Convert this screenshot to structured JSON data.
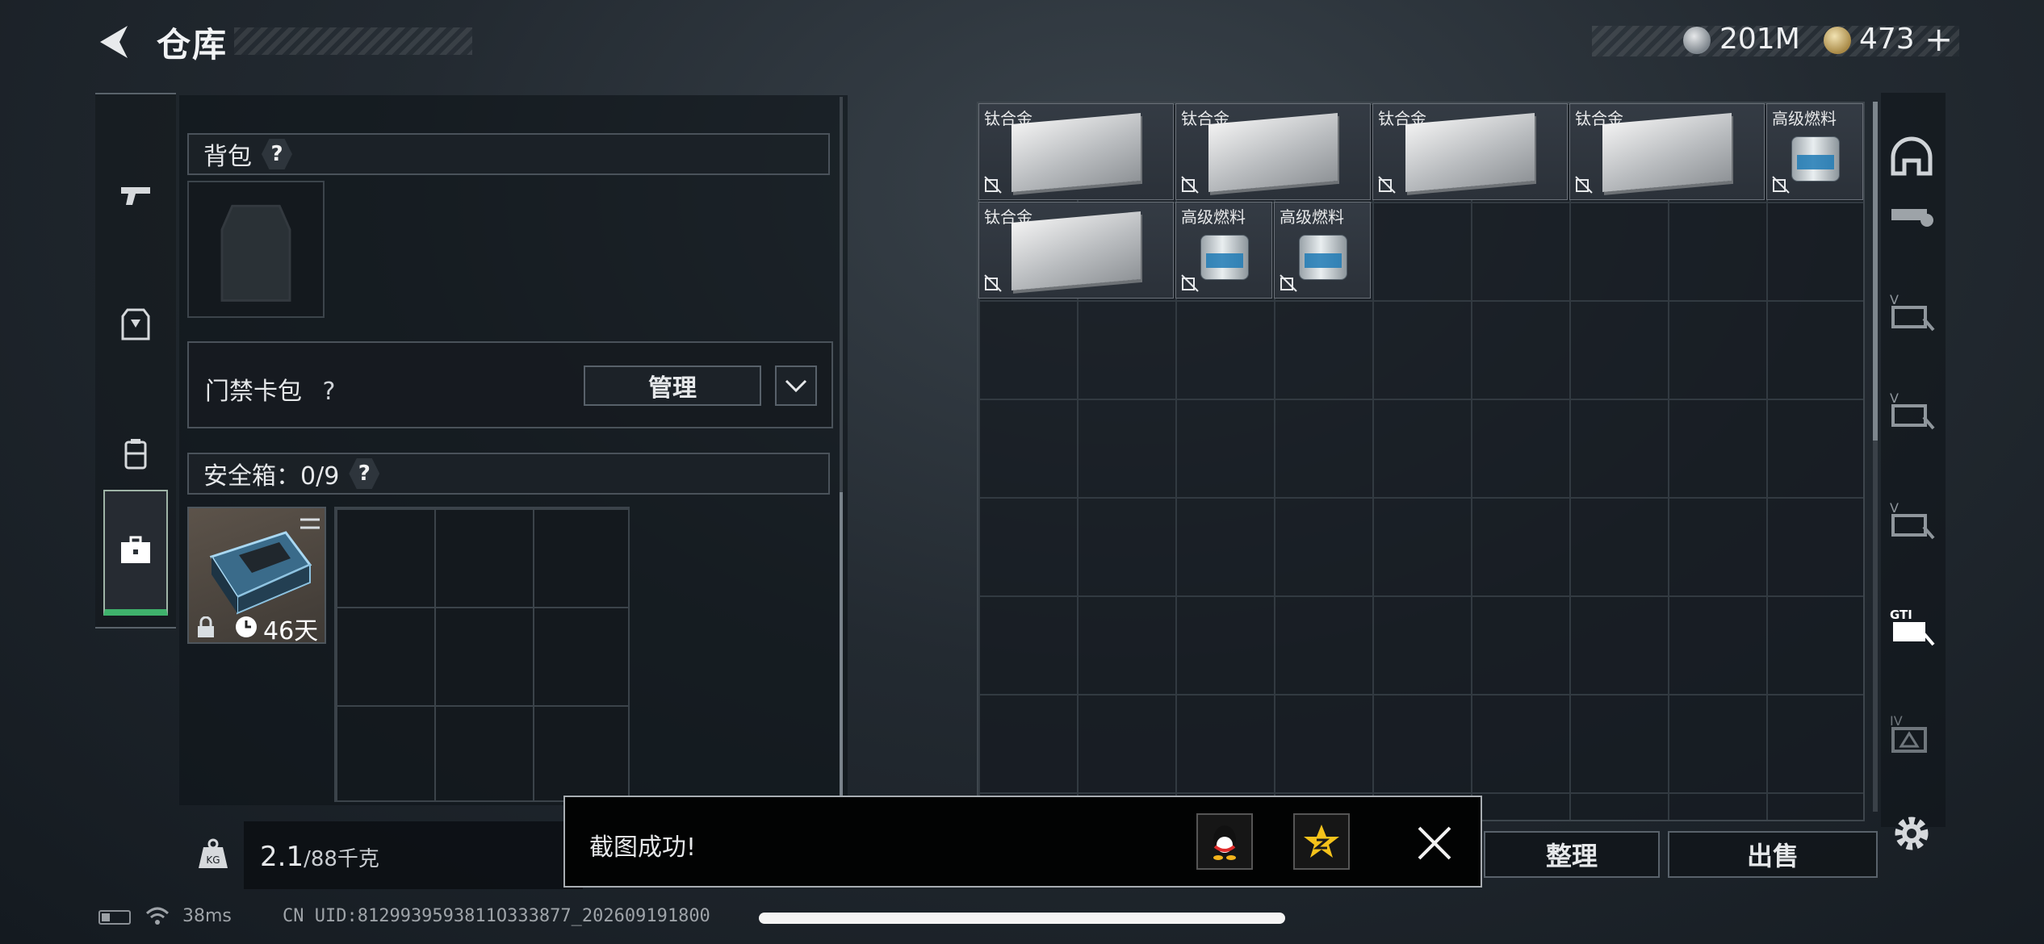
{
  "header": {
    "title": "仓库",
    "currency_silver": "201M",
    "currency_gold": "473",
    "add_currency": "+"
  },
  "left_nav": {
    "items": [
      {
        "name": "weapons",
        "icon": "gun-icon"
      },
      {
        "name": "armor",
        "icon": "vest-icon"
      },
      {
        "name": "backpack",
        "icon": "bag-icon"
      },
      {
        "name": "safe-case",
        "icon": "briefcase-icon",
        "active": true
      }
    ]
  },
  "equipment": {
    "backpack_label": "背包",
    "question": "?",
    "keycard_label": "门禁卡包",
    "manage_label": "管理",
    "safebox_label": "安全箱：0/9",
    "case_days": "46天"
  },
  "weight": {
    "current": "2.1",
    "max": "/88千克",
    "icon_text": "KG"
  },
  "storage": {
    "items": [
      {
        "name": "钛合金",
        "type": "titanium"
      },
      {
        "name": "钛合金",
        "type": "titanium"
      },
      {
        "name": "钛合金",
        "type": "titanium"
      },
      {
        "name": "钛合金",
        "type": "titanium"
      },
      {
        "name": "高级燃料",
        "type": "fuel"
      },
      {
        "name": "钛合金",
        "type": "titanium"
      },
      {
        "name": "高级燃料",
        "type": "fuel"
      },
      {
        "name": "高级燃料",
        "type": "fuel"
      }
    ]
  },
  "actions": {
    "sort_label": "整理",
    "sell_label": "出售"
  },
  "right_bar": {
    "icons": [
      "helmet-icon",
      "armor-plate-icon",
      "v-armor-icon",
      "v-armor-icon",
      "v-armor-icon",
      "gti-armor-icon",
      "iv-armor-icon"
    ],
    "labels": [
      "V",
      "V",
      "V",
      "GTI",
      "IV"
    ]
  },
  "toast": {
    "message": "截图成功!",
    "share_qq": "qq-icon",
    "share_qzone": "qzone-icon"
  },
  "status": {
    "ping": "38ms",
    "uid": "CN UID:8129939593811O333877_202609191800"
  },
  "colors": {
    "accent_green": "#3fb26c",
    "fuel_blue": "#1e7ab5"
  }
}
